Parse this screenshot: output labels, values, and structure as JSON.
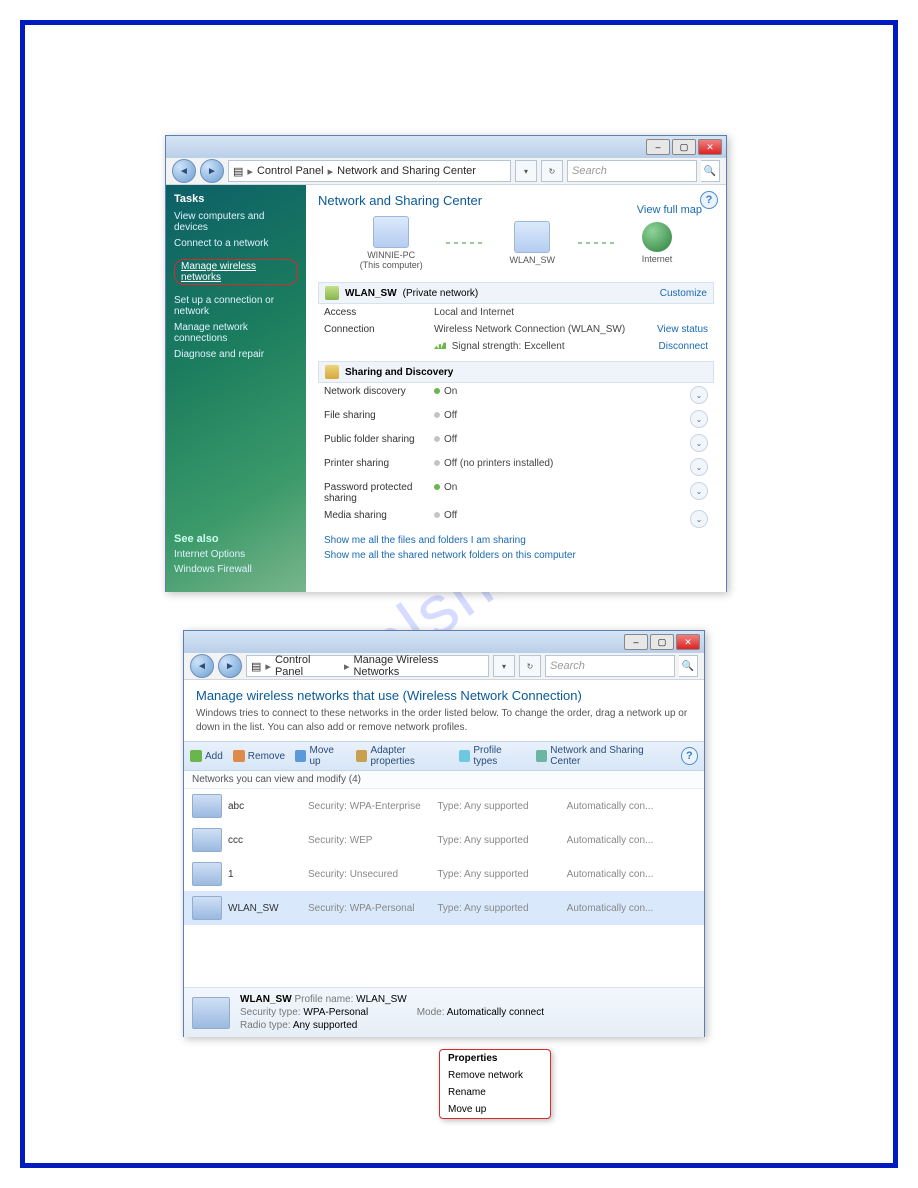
{
  "watermark": "manualshive.com",
  "win1": {
    "breadcrumb": {
      "a": "Control Panel",
      "b": "Network and Sharing Center"
    },
    "search_placeholder": "Search",
    "sidebar": {
      "heading": "Tasks",
      "items": {
        "view": "View computers and devices",
        "connect": "Connect to a network",
        "manage_wireless": "Manage wireless networks",
        "setup": "Set up a connection or network",
        "manage_conn": "Manage network connections",
        "diag": "Diagnose and repair"
      },
      "seealso": {
        "hdr": "See also",
        "a": "Internet Options",
        "b": "Windows Firewall"
      }
    },
    "title": "Network and Sharing Center",
    "view_full_map": "View full map",
    "map": {
      "node1_name": "WINNIE-PC",
      "node1_sub": "(This computer)",
      "node2_name": "WLAN_SW",
      "node3_name": "Internet"
    },
    "net_bar": {
      "name": "WLAN_SW",
      "scope": "(Private network)",
      "customize": "Customize"
    },
    "access": {
      "label": "Access",
      "value": "Local and Internet"
    },
    "connection": {
      "label": "Connection",
      "value": "Wireless Network Connection (WLAN_SW)",
      "view_status": "View status"
    },
    "signal": {
      "label": "Signal strength:",
      "value": "Excellent",
      "disconnect": "Disconnect"
    },
    "sharing_hdr": "Sharing and Discovery",
    "rows": {
      "netdisc": {
        "label": "Network discovery",
        "state": "On"
      },
      "fileshare": {
        "label": "File sharing",
        "state": "Off"
      },
      "pubfolder": {
        "label": "Public folder sharing",
        "state": "Off"
      },
      "printer": {
        "label": "Printer sharing",
        "state": "Off (no printers installed)"
      },
      "password": {
        "label": "Password protected sharing",
        "state": "On"
      },
      "media": {
        "label": "Media sharing",
        "state": "Off"
      }
    },
    "link1": "Show me all the files and folders I am sharing",
    "link2": "Show me all the shared network folders on this computer"
  },
  "win2": {
    "breadcrumb": {
      "a": "Control Panel",
      "b": "Manage Wireless Networks"
    },
    "search_placeholder": "Search",
    "title": "Manage wireless networks that use (Wireless Network Connection)",
    "subtext": "Windows tries to connect to these networks in the order listed below. To change the order, drag a network up or down in the list. You can also add or remove network profiles.",
    "toolbar": {
      "add": "Add",
      "remove": "Remove",
      "moveup": "Move up",
      "adapter": "Adapter properties",
      "profile": "Profile types",
      "netshare": "Network and Sharing Center"
    },
    "group_header": "Networks you can view and modify (4)",
    "cols": {
      "sec_prefix": "Security:",
      "type_prefix": "Type:",
      "auto_prefix": ""
    },
    "rows": [
      {
        "name": "abc",
        "security": "WPA-Enterprise",
        "type": "Any supported",
        "auto": "Automatically con..."
      },
      {
        "name": "ccc",
        "security": "WEP",
        "type": "Any supported",
        "auto": "Automatically con..."
      },
      {
        "name": "1",
        "security": "Unsecured",
        "type": "Any supported",
        "auto": "Automatically con..."
      },
      {
        "name": "WLAN_SW",
        "security": "WPA-Personal",
        "type": "Any supported",
        "auto": "Automatically con..."
      }
    ],
    "ctxmenu": {
      "a": "Properties",
      "b": "Remove network",
      "c": "Rename",
      "d": "Move up"
    },
    "detail": {
      "name": "WLAN_SW",
      "profile_label": "Profile name:",
      "profile_value": "WLAN_SW",
      "sec_label": "Security type:",
      "sec_value": "WPA-Personal",
      "radio_label": "Radio type:",
      "radio_value": "Any supported",
      "mode_label": "Mode:",
      "mode_value": "Automatically connect"
    }
  }
}
